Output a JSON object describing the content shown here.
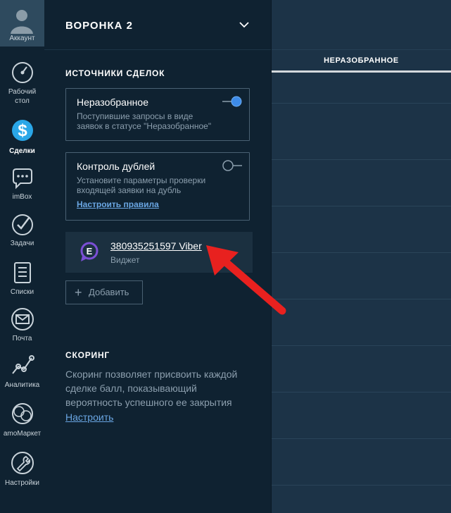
{
  "nav": {
    "account_label": "Аккаунт",
    "items": [
      {
        "label": "Рабочий\nстол",
        "icon": "dashboard-icon"
      },
      {
        "label": "Сделки",
        "icon": "deals-icon",
        "active": true
      },
      {
        "label": "imBox",
        "icon": "chat-icon"
      },
      {
        "label": "Задачи",
        "icon": "check-icon"
      },
      {
        "label": "Списки",
        "icon": "list-icon"
      },
      {
        "label": "Почта",
        "icon": "mail-icon"
      },
      {
        "label": "Аналитика",
        "icon": "analytics-icon"
      },
      {
        "label": "amoМаркет",
        "icon": "market-icon"
      },
      {
        "label": "Настройки",
        "icon": "wrench-icon"
      }
    ]
  },
  "panel": {
    "title": "ВОРОНКА 2",
    "sources_title": "ИСТОЧНИКИ СДЕЛОК",
    "unsorted": {
      "title": "Неразобранное",
      "desc": "Поступившие запросы в виде заявок в статусе \"Неразобранное\"",
      "enabled": true
    },
    "duplicates": {
      "title": "Контроль дублей",
      "desc": "Установите параметры проверки входящей заявки на дубль",
      "link": "Настроить правила",
      "enabled": false
    },
    "widget": {
      "name": "380935251597 Viber",
      "type": "Виджет"
    },
    "add_label": "Добавить",
    "scoring_title": "СКОРИНГ",
    "scoring_desc": "Скоринг позволяет присвоить каждой сделке балл, показывающий вероятность успешного ее закрытия",
    "scoring_link": "Настроить"
  },
  "board": {
    "column_title": "НЕРАЗОБРАННОЕ"
  },
  "colors": {
    "accent_blue": "#3d8be8",
    "link": "#6aa6e3",
    "arrow": "#e8211f",
    "deals_icon": "#2aa7e8"
  }
}
